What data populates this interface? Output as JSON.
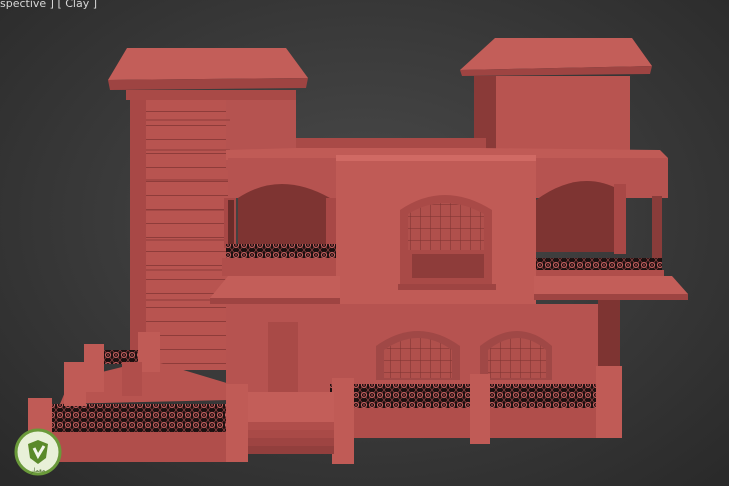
{
  "viewport": {
    "label": "spective ] [ Clay ]",
    "shading_mode": "Clay"
  },
  "scene": {
    "object": "villa-model",
    "material_color": "#b85450"
  },
  "logo": {
    "icon": "shield-leaf-icon",
    "text": "معمار"
  }
}
